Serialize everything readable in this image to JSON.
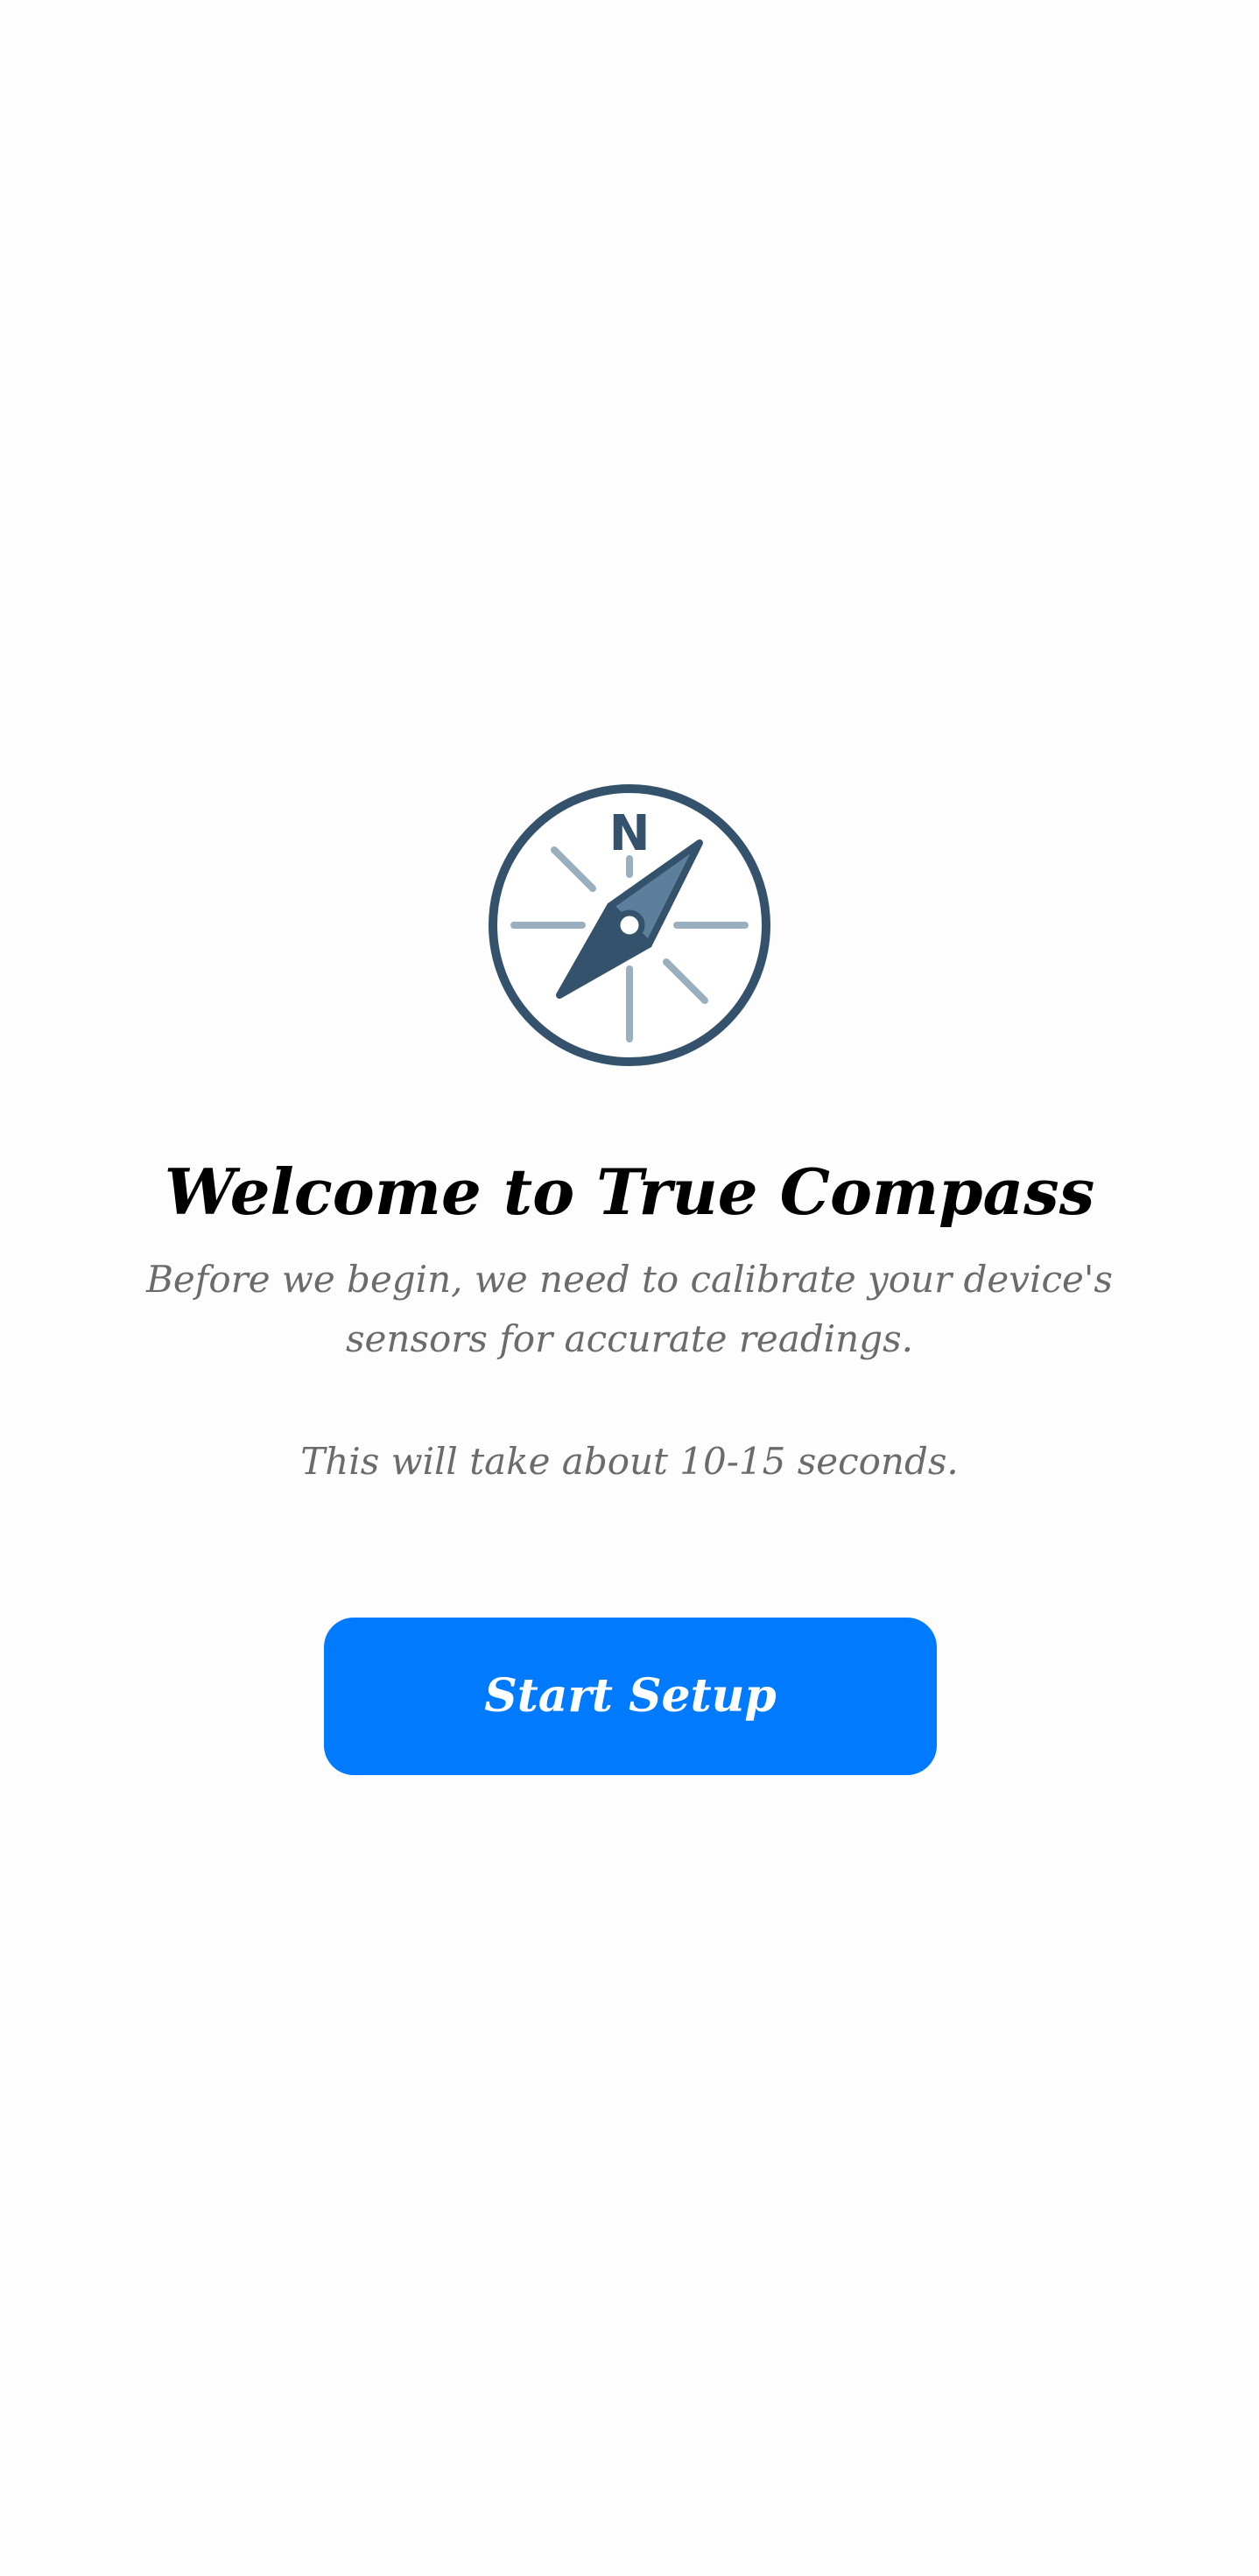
{
  "compass": {
    "north_label": "N",
    "icon": "compass-icon"
  },
  "welcome": {
    "title": "Welcome to True Compass",
    "description": "Before we begin, we need to calibrate your device's sensors for accurate readings.",
    "duration_note": "This will take about 10-15 seconds."
  },
  "actions": {
    "start_label": "Start Setup"
  },
  "colors": {
    "primary": "#007aff",
    "compass_dark": "#34526b",
    "compass_light": "#9ab0bf",
    "text_muted": "#6b6b6b"
  }
}
